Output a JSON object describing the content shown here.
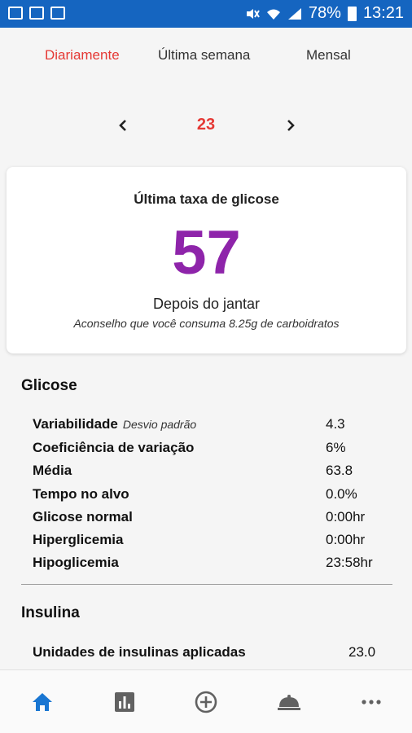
{
  "status_bar": {
    "battery": "78%",
    "time": "13:21"
  },
  "tabs": [
    {
      "label": "Diariamente",
      "active": true
    },
    {
      "label": "Última semana",
      "active": false
    },
    {
      "label": "Mensal",
      "active": false
    }
  ],
  "date_nav": {
    "value": "23"
  },
  "card": {
    "title": "Última taxa de glicose",
    "value": "57",
    "meal": "Depois do jantar",
    "advice": "Aconselho que você consuma 8.25g de carboidratos"
  },
  "glucose": {
    "title": "Glicose",
    "rows": [
      {
        "label": "Variabilidade",
        "sub": "Desvio padrão",
        "value": "4.3"
      },
      {
        "label": "Coeficiência de variação",
        "value": "6%"
      },
      {
        "label": "Média",
        "value": "63.8"
      },
      {
        "label": "Tempo no alvo",
        "value": "0.0%"
      },
      {
        "label": "Glicose normal",
        "value": "0:00hr"
      },
      {
        "label": "Hiperglicemia",
        "value": "0:00hr"
      },
      {
        "label": "Hipoglicemia",
        "value": "23:58hr"
      }
    ]
  },
  "insulin": {
    "title": "Insulina",
    "rows": [
      {
        "label": "Unidades de insulinas aplicadas",
        "value": "23.0"
      }
    ]
  },
  "bottom_nav": [
    {
      "icon": "home-icon",
      "active": true
    },
    {
      "icon": "bar-chart-icon",
      "active": false
    },
    {
      "icon": "add-circle-icon",
      "active": false
    },
    {
      "icon": "meal-cloche-icon",
      "active": false
    },
    {
      "icon": "more-icon",
      "active": false
    }
  ],
  "colors": {
    "status_bar": "#1565c0",
    "accent_red": "#e53935",
    "glucose_value": "#8e24aa",
    "nav_active": "#1976d2",
    "nav_inactive": "#616161"
  }
}
